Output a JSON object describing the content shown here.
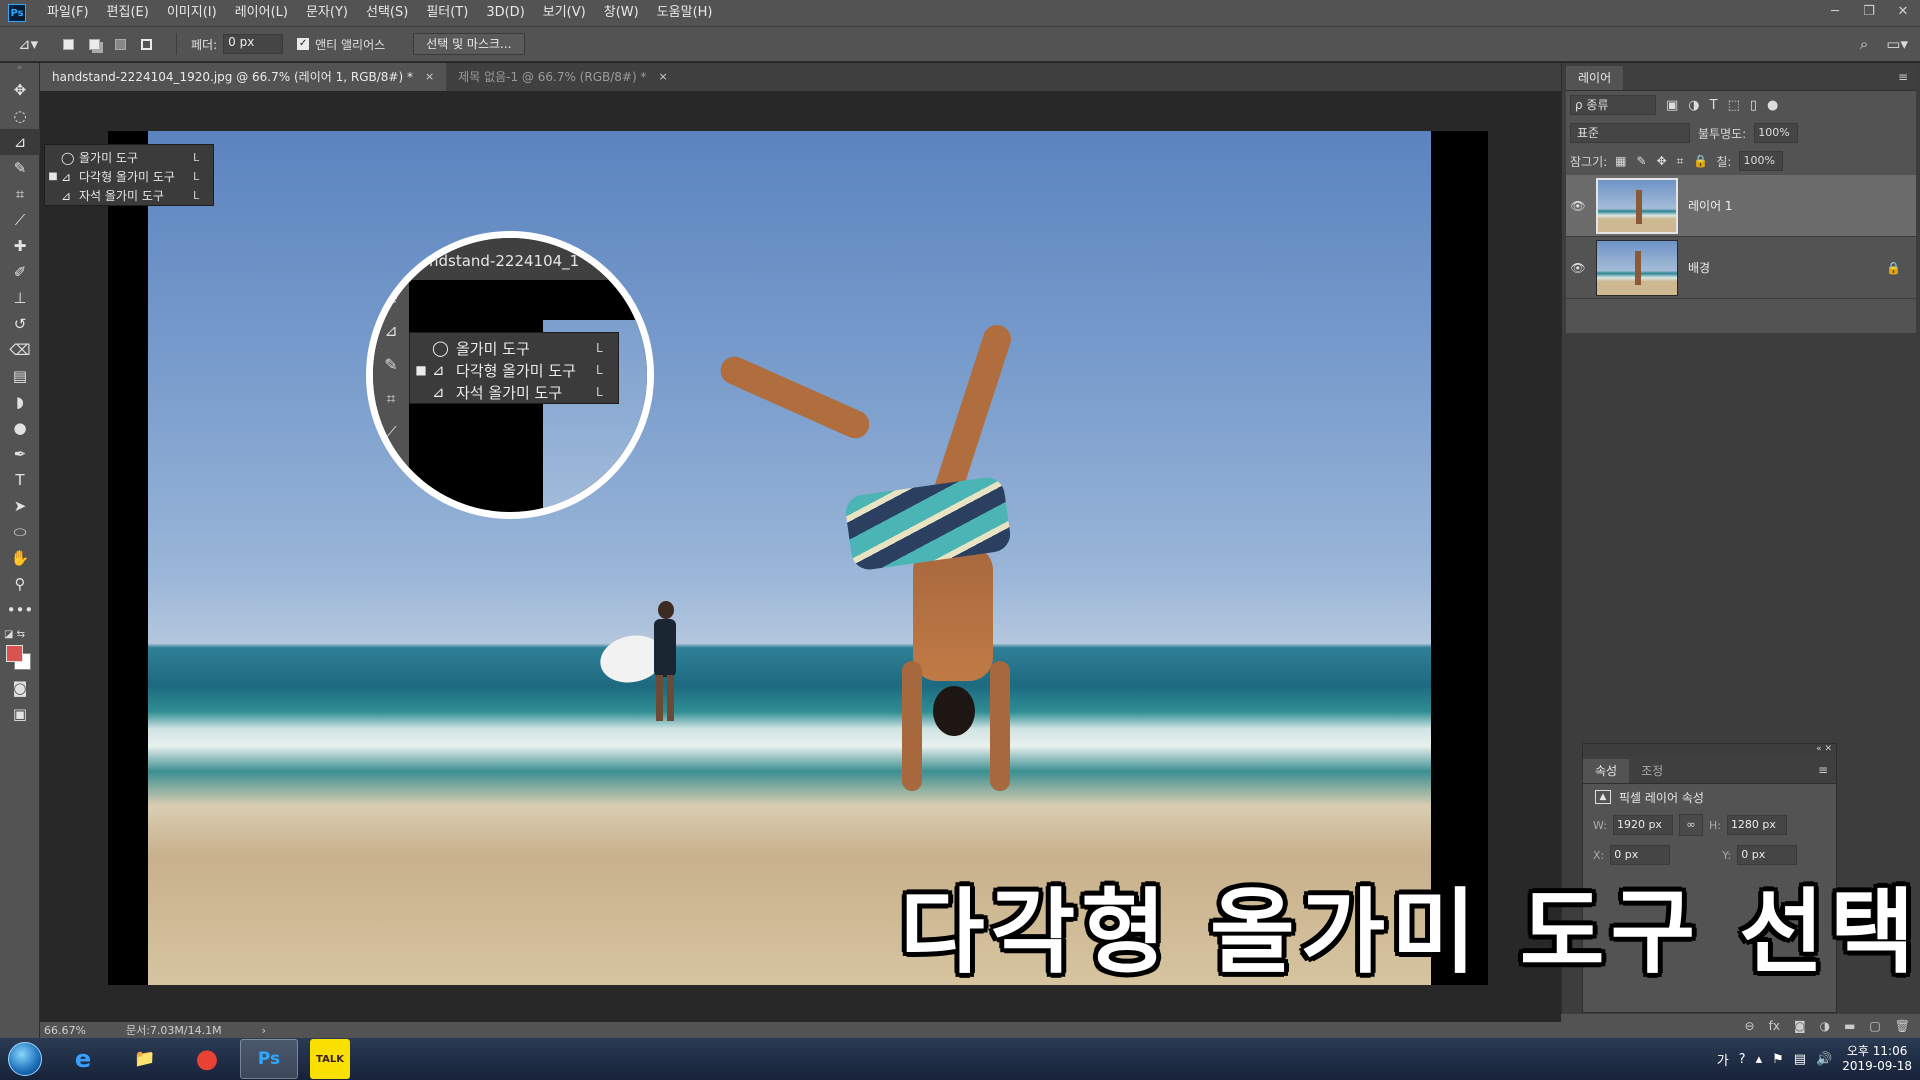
{
  "menubar": {
    "logo": "Ps",
    "items": [
      "파일(F)",
      "편집(E)",
      "이미지(I)",
      "레이어(L)",
      "문자(Y)",
      "선택(S)",
      "필터(T)",
      "3D(D)",
      "보기(V)",
      "창(W)",
      "도움말(H)"
    ],
    "window_controls": [
      "─",
      "❐",
      "✕"
    ]
  },
  "options": {
    "feather_label": "페더:",
    "feather_value": "0 px",
    "antialias_label": "앤티 앨리어스",
    "antialias_checked": true,
    "select_mask_label": "선택 및 마스크..."
  },
  "tabs": [
    {
      "label": "handstand-2224104_1920.jpg @ 66.7% (레이어 1, RGB/8#) *",
      "close": "×"
    },
    {
      "label": "제목 없음-1 @ 66.7% (RGB/8#) *",
      "close": "×"
    }
  ],
  "flyout": {
    "items": [
      {
        "label": "올가미 도구",
        "key": "L",
        "selected": false,
        "icon": "lasso-icon"
      },
      {
        "label": "다각형 올가미 도구",
        "key": "L",
        "selected": true,
        "icon": "polygonal-lasso-icon"
      },
      {
        "label": "자석 올가미 도구",
        "key": "L",
        "selected": false,
        "icon": "magnetic-lasso-icon"
      }
    ],
    "bullet": "■"
  },
  "magnifier": {
    "tab_text": "ndstand-2224104_1"
  },
  "caption": "다각형 올가미 도구 선택",
  "status": {
    "zoom": "66.67%",
    "doc": "문서:7.03M/14.1M",
    "arrow": "›"
  },
  "layers_panel": {
    "tab": "레이어",
    "filter_kind": "ρ 종류",
    "blend_mode": "표준",
    "opacity_label": "불투명도:",
    "opacity": "100%",
    "lock_label": "잠그기:",
    "fill_label": "칠:",
    "fill": "100%",
    "layers": [
      {
        "name": "레이어 1",
        "selected": true,
        "locked": false
      },
      {
        "name": "배경",
        "selected": false,
        "locked": true
      }
    ]
  },
  "properties_panel": {
    "tabs": [
      "속성",
      "조정"
    ],
    "title": "픽셀 레이어 속성",
    "w_label": "W:",
    "w_value": "1920 px",
    "h_label": "H:",
    "h_value": "1280 px",
    "x_label": "X:",
    "x_value": "0 px",
    "y_label": "Y:",
    "y_value": "0 px"
  },
  "taskbar": {
    "apps": [
      "e",
      "📁",
      "●",
      "Ps",
      "TALK"
    ],
    "ime": "가",
    "clock_time": "오후 11:06",
    "clock_date": "2019-09-18"
  },
  "colors": {
    "foreground": "#d9534f",
    "background": "#ffffff",
    "accent": "#31a8ff"
  }
}
